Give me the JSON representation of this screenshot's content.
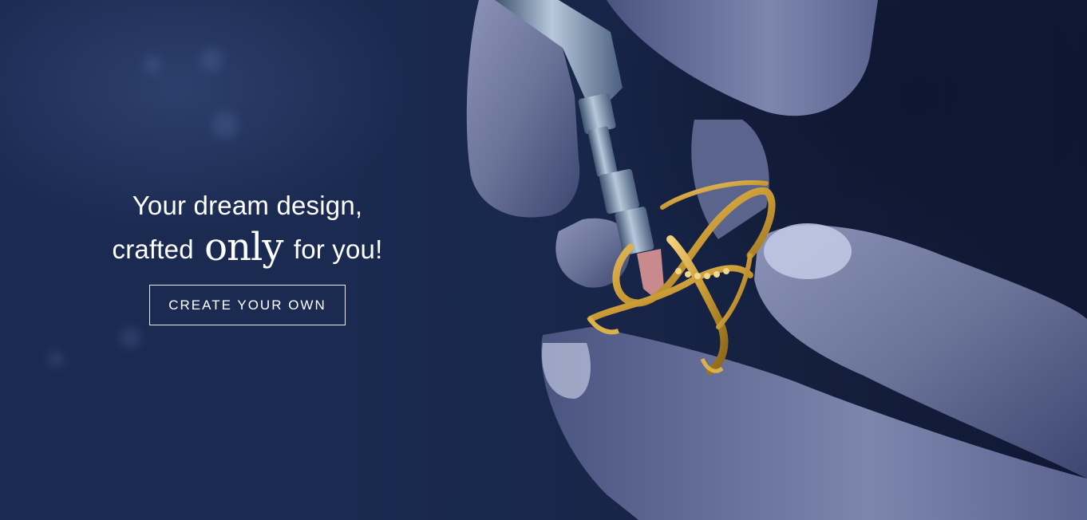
{
  "hero": {
    "headline_line1": "Your dream design,",
    "headline_line2_before": "crafted",
    "headline_line2_accent": "only",
    "headline_line2_after": "for you!",
    "cta_label": "CREATE YOUR OWN"
  },
  "colors": {
    "background": "#1a2a50",
    "text": "#ffffff",
    "gold": "#d9b24a"
  }
}
